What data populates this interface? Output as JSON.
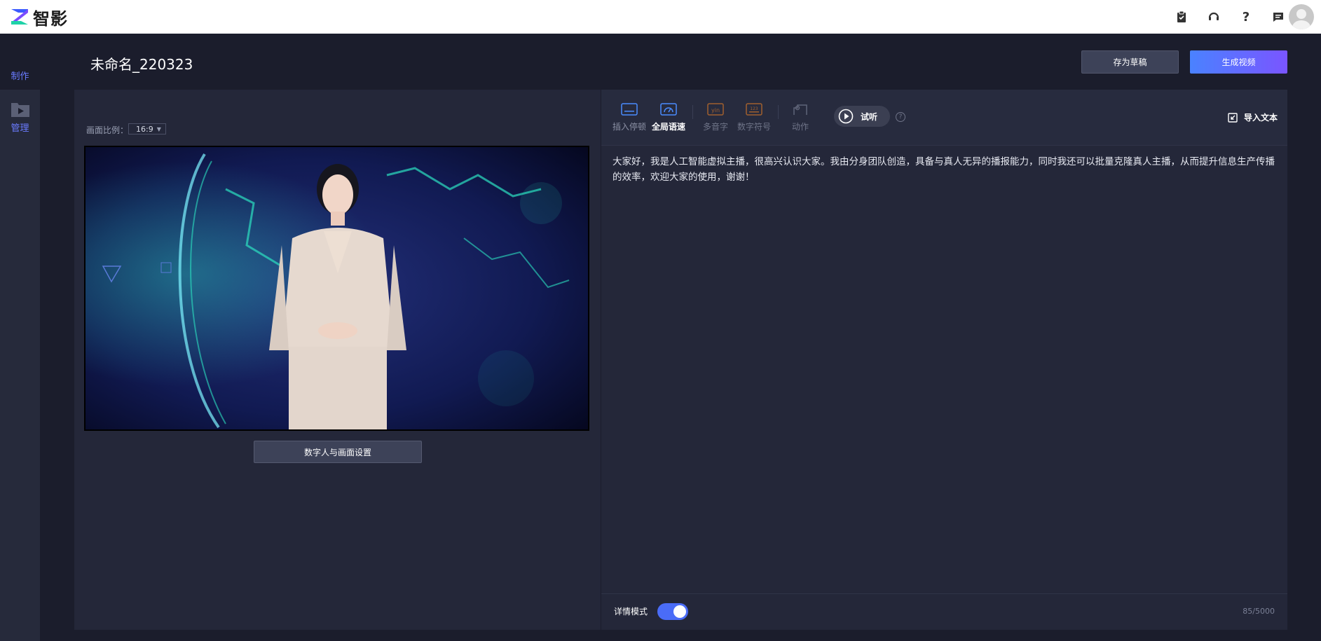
{
  "app": {
    "logo_text": "智影",
    "brand_color": "#1fd2a8"
  },
  "topbar": {
    "icons": [
      "clipboard-check-icon",
      "headset-icon",
      "help-icon",
      "message-icon"
    ],
    "help_glyph": "?"
  },
  "rail": {
    "make_label": "制作",
    "manage_label": "管理",
    "active_color": "#6a7bff"
  },
  "header": {
    "title": "未命名_220323",
    "save_draft_label": "存为草稿",
    "generate_label": "生成视频"
  },
  "canvas": {
    "ratio_label": "画面比例：",
    "ratio_value": "16:9",
    "settings_button_label": "数字人与画面设置"
  },
  "editor": {
    "tools": [
      {
        "label": "插入停顿",
        "icon": "pause-insert-icon",
        "state": "normal"
      },
      {
        "label": "全局语速",
        "icon": "speedometer-icon",
        "state": "active"
      },
      {
        "label": "多音字",
        "icon": "pinyin-icon",
        "state": "disabled"
      },
      {
        "label": "数字符号",
        "icon": "number-symbol-icon",
        "state": "disabled"
      },
      {
        "label": "动作",
        "icon": "gesture-icon",
        "state": "disabled"
      }
    ],
    "listen_label": "试听",
    "help_glyph": "?",
    "import_label": "导入文本",
    "script_text": "大家好，我是人工智能虚拟主播，很高兴认识大家。我由分身团队创造，具备与真人无异的播报能力，同时我还可以批量克隆真人主播，从而提升信息生产传播的效率，欢迎大家的使用，谢谢！",
    "detail_mode_label": "详情模式",
    "detail_mode_on": true,
    "char_count": "85/5000"
  }
}
